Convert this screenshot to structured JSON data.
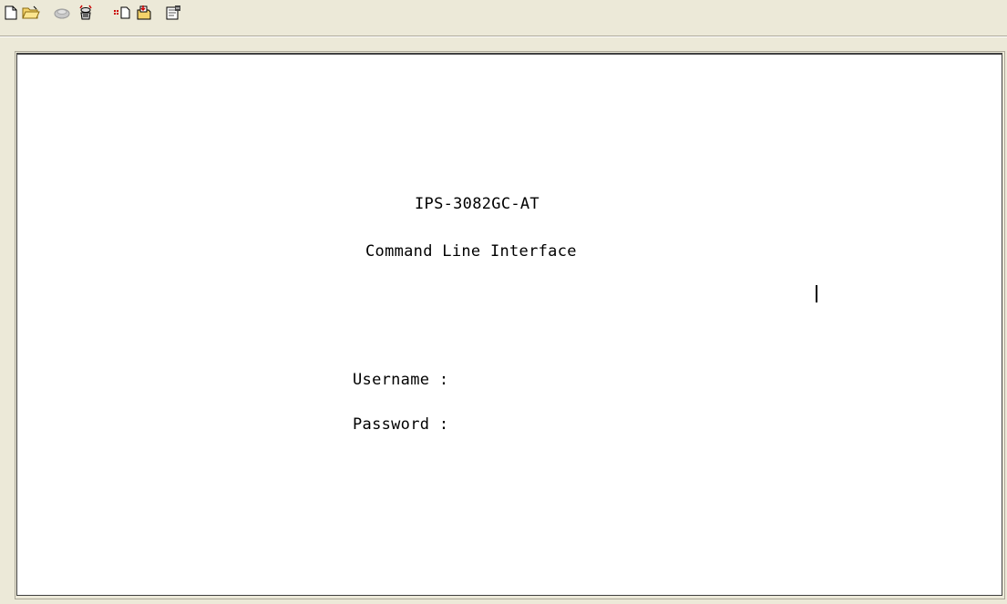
{
  "toolbar": {
    "tools": [
      {
        "icon": "new-file-icon"
      },
      {
        "icon": "open-folder-icon"
      },
      {
        "icon": "disconnect-icon"
      },
      {
        "icon": "connect-icon"
      },
      {
        "icon": "send-icon"
      },
      {
        "icon": "receive-icon"
      },
      {
        "icon": "properties-icon"
      }
    ]
  },
  "terminal": {
    "model": "IPS-3082GC-AT",
    "subtitle": "Command Line Interface",
    "username_prompt": "Username :",
    "password_prompt": "Password :"
  },
  "colors": {
    "chrome": "#ece9d8",
    "terminal_bg": "#ffffff",
    "text": "#000000"
  }
}
